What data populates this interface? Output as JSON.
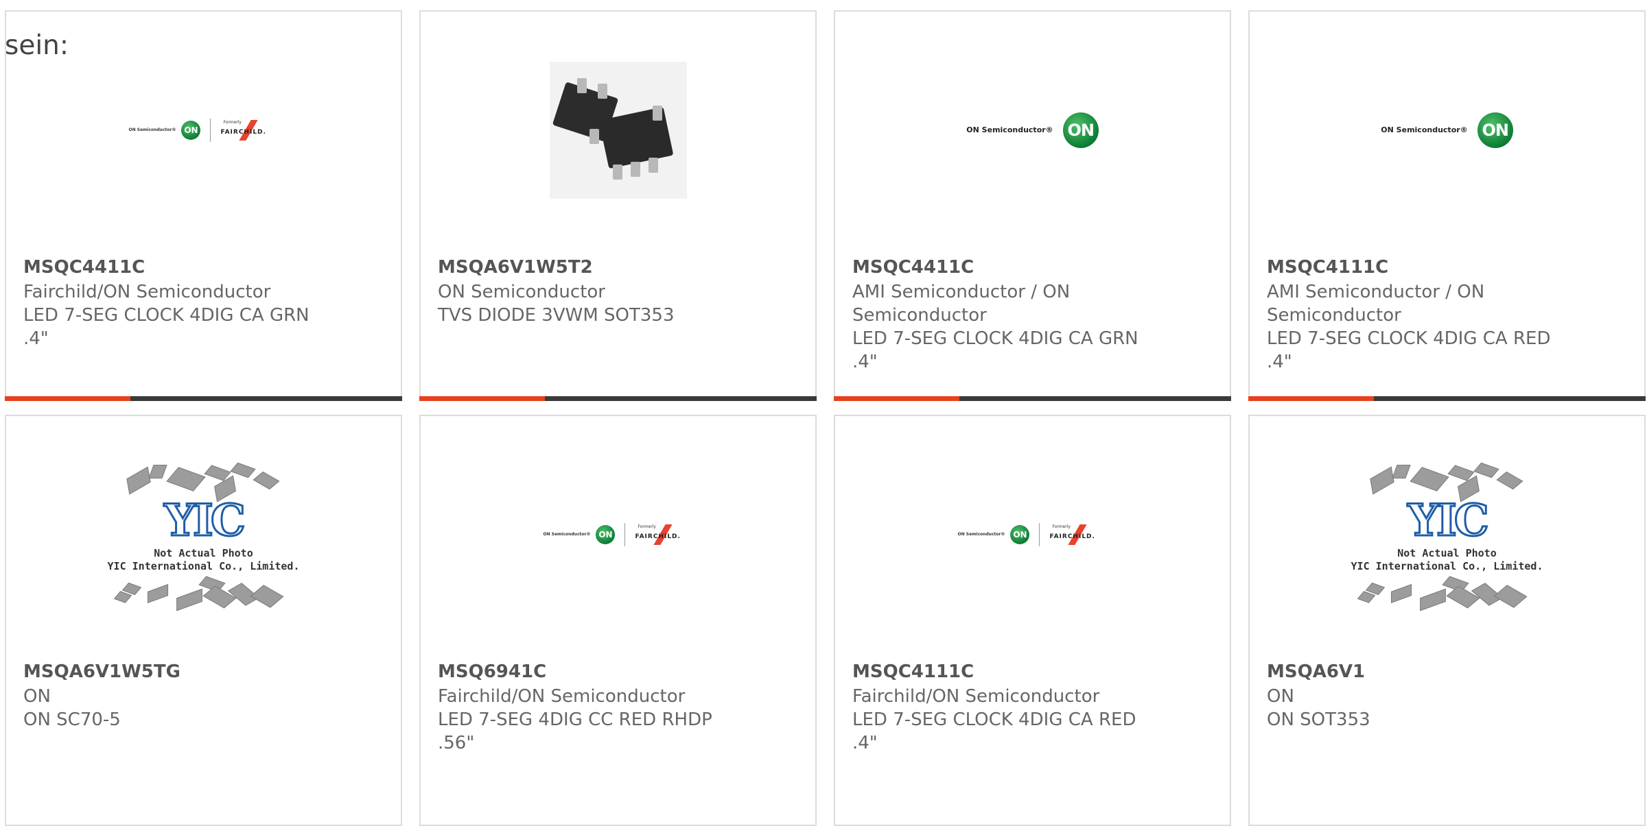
{
  "heading": "sein:",
  "colors": {
    "accent": "#e8411e",
    "dark_bar": "#3a3a3a",
    "border": "#dcdcdc"
  },
  "products": [
    {
      "part": "MSQC4411C",
      "manufacturer": "Fairchild/ON Semiconductor",
      "description": "LED 7-SEG CLOCK 4DIG CA GRN .4\"",
      "image": "on-fairchild-logo"
    },
    {
      "part": "MSQA6V1W5T2",
      "manufacturer": "ON Semiconductor",
      "description": "TVS DIODE 3VWM SOT353",
      "image": "tvs-diode-photo"
    },
    {
      "part": "MSQC4411C",
      "manufacturer": "AMI Semiconductor / ON Semiconductor",
      "description": "LED 7-SEG CLOCK 4DIG CA GRN .4\"",
      "image": "on-semiconductor-logo"
    },
    {
      "part": "MSQC4111C",
      "manufacturer": "AMI Semiconductor / ON Semiconductor",
      "description": "LED 7-SEG CLOCK 4DIG CA RED .4\"",
      "image": "on-semiconductor-logo"
    },
    {
      "part": "MSQA6V1W5TG",
      "manufacturer": "ON",
      "description": "ON SC70-5",
      "image": "yic-placeholder"
    },
    {
      "part": "MSQ6941C",
      "manufacturer": "Fairchild/ON Semiconductor",
      "description": "LED 7-SEG 4DIG CC RED RHDP .56\"",
      "image": "on-fairchild-logo"
    },
    {
      "part": "MSQC4111C",
      "manufacturer": "Fairchild/ON Semiconductor",
      "description": "LED 7-SEG CLOCK 4DIG CA RED .4\"",
      "image": "on-fairchild-logo"
    },
    {
      "part": "MSQA6V1",
      "manufacturer": "ON",
      "description": "ON SOT353",
      "image": "yic-placeholder"
    }
  ],
  "logos": {
    "on_brand": "ON Semiconductor®",
    "on_mark": "ON",
    "formerly": "Formerly",
    "fairchild": "FAIRCHILD.",
    "yic_mark": "YIC",
    "yic_note_line1": "Not Actual Photo",
    "yic_note_line2": "YIC International Co., Limited."
  }
}
